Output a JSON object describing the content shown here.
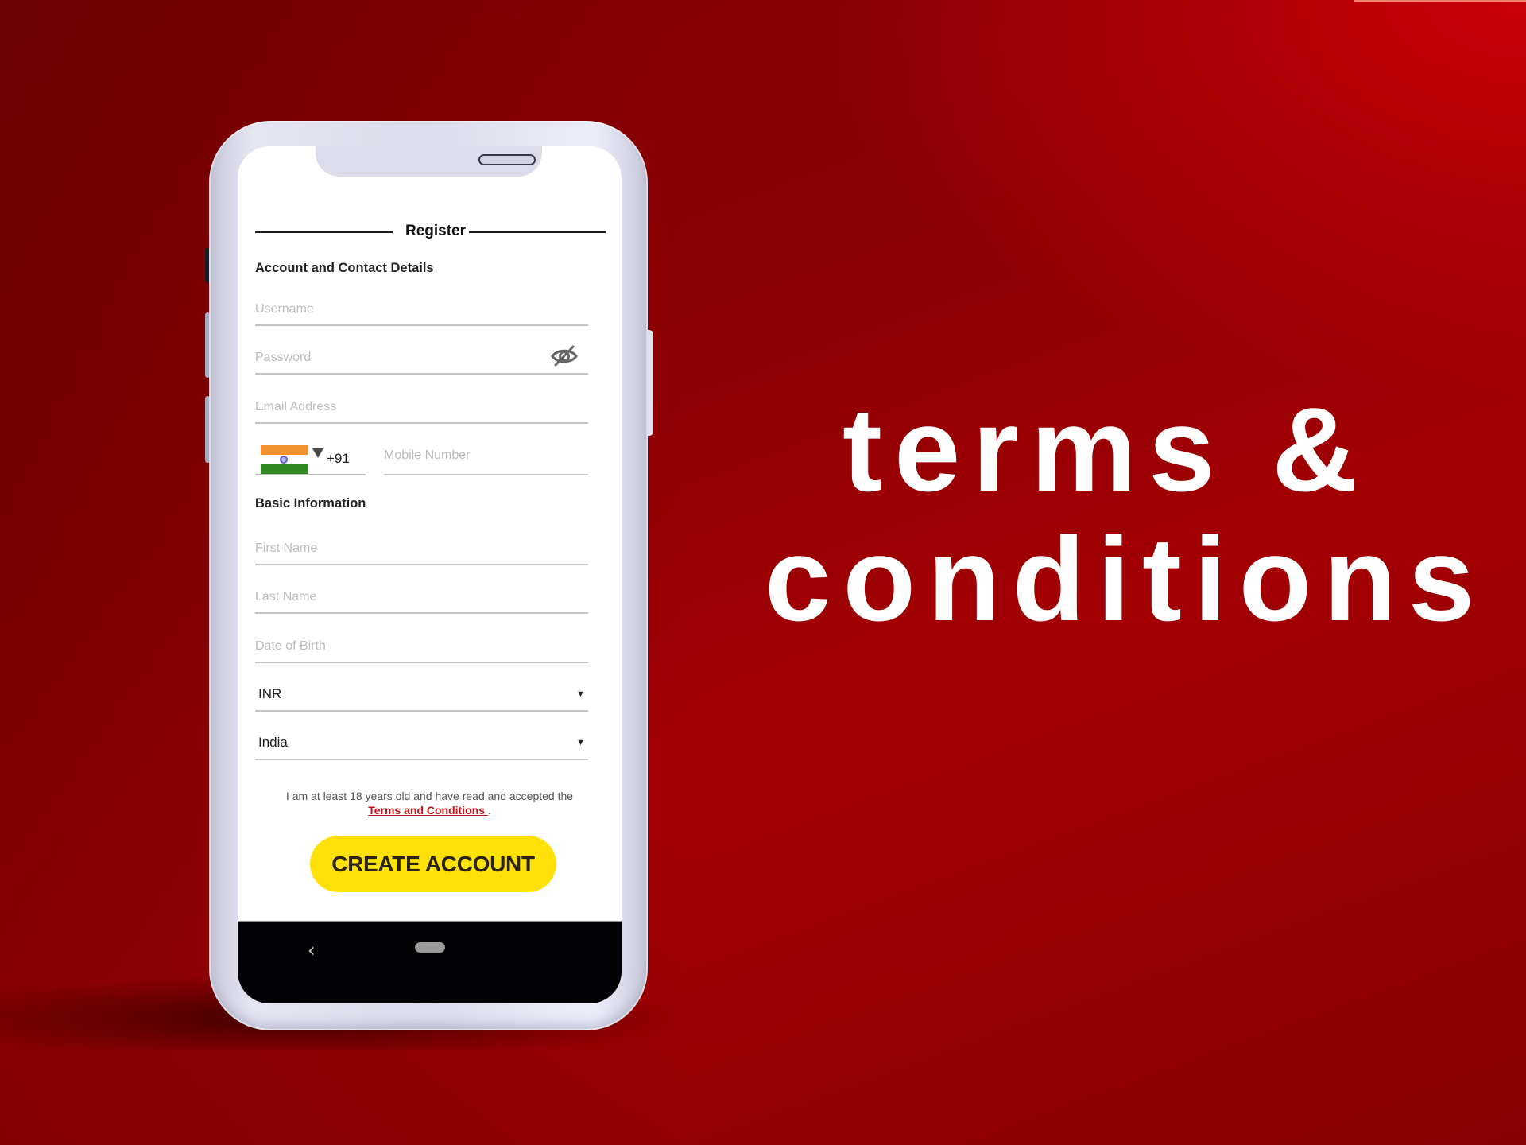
{
  "background": {
    "accent_top_right": "#c50005",
    "base": "#8e0002"
  },
  "headline": {
    "line1": "terms &",
    "line2": "conditions"
  },
  "phone_ui": {
    "form_title": "Register",
    "sections": {
      "account": "Account and Contact Details",
      "basic": "Basic Information"
    },
    "fields": {
      "username": {
        "placeholder": "Username",
        "value": ""
      },
      "password": {
        "placeholder": "Password",
        "value": "",
        "toggle_icon": "eye-slash-icon"
      },
      "email": {
        "placeholder": "Email Address",
        "value": ""
      },
      "country_code": {
        "flag": "India",
        "value": "+91"
      },
      "mobile": {
        "placeholder": "Mobile Number",
        "value": ""
      },
      "first_name": {
        "placeholder": "First Name",
        "value": ""
      },
      "last_name": {
        "placeholder": "Last Name",
        "value": ""
      },
      "dob": {
        "placeholder": "Date of Birth",
        "value": ""
      },
      "currency": {
        "value": "INR",
        "caret": "▼"
      },
      "country": {
        "value": "India",
        "caret": "▼"
      }
    },
    "terms": {
      "text": "I am at least 18 years old and have read and accepted the",
      "link": "Terms and Conditions ",
      "suffix": "."
    },
    "cta": {
      "label": "CREATE ACCOUNT",
      "color": "#ffe10a"
    },
    "navbar": {
      "back_icon": "‹"
    }
  }
}
